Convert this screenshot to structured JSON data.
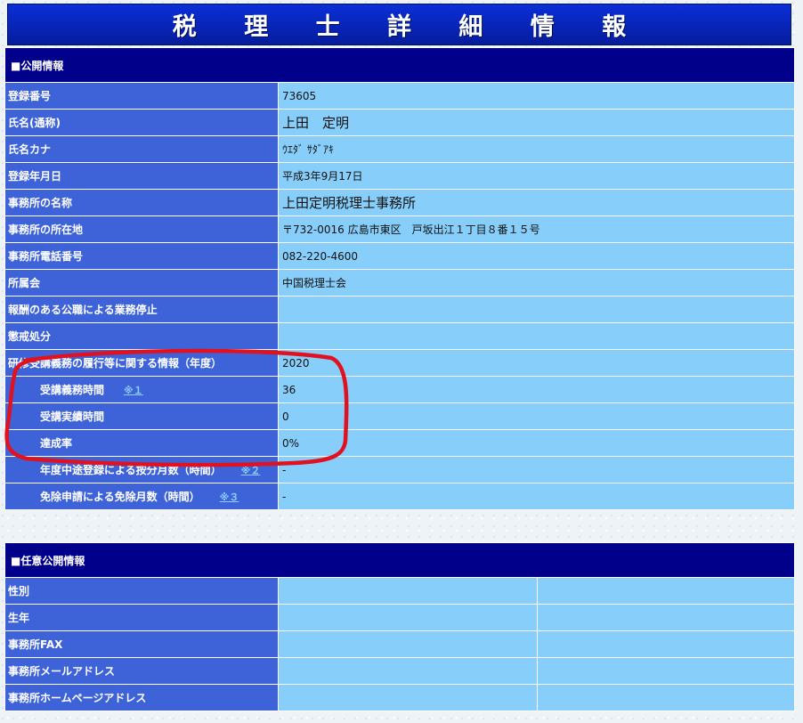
{
  "title": "税 理 士 詳 細 情 報",
  "public_section": {
    "header": "■公開情報",
    "rows": [
      {
        "label": "登録番号",
        "value": "73605"
      },
      {
        "label": "氏名(通称)",
        "value": "上田　定明"
      },
      {
        "label": "氏名カナ",
        "value": "ｳｴﾀﾞ ｻﾀﾞｱｷ"
      },
      {
        "label": "登録年月日",
        "value": "平成3年9月17日"
      },
      {
        "label": "事務所の名称",
        "value": "上田定明税理士事務所"
      },
      {
        "label": "事務所の所在地",
        "value": "〒732-0016 広島市東区　戸坂出江１丁目８番１５号"
      },
      {
        "label": "事務所電話番号",
        "value": "082-220-4600"
      },
      {
        "label": "所属会",
        "value": "中国税理士会"
      },
      {
        "label": "報酬のある公職による業務停止",
        "value": ""
      },
      {
        "label": "懲戒処分",
        "value": ""
      },
      {
        "label": "研修受講義務の履行等に関する情報（年度）",
        "value": "2020"
      },
      {
        "label": "受講義務時間",
        "note": "※１",
        "value": "36"
      },
      {
        "label": "受講実績時間",
        "value": "0"
      },
      {
        "label": "達成率",
        "value": "0%"
      },
      {
        "label": "年度中途登録による按分月数（時間）",
        "note": "※２",
        "value": "-"
      },
      {
        "label": "免除申請による免除月数（時間）",
        "note": "※３",
        "value": "-"
      }
    ]
  },
  "optional_section": {
    "header": "■任意公開情報",
    "rows": [
      {
        "label": "性別"
      },
      {
        "label": "生年"
      },
      {
        "label": "事務所FAX"
      },
      {
        "label": "事務所メールアドレス"
      },
      {
        "label": "事務所ホームページアドレス"
      }
    ]
  },
  "annotation_color": "#e0121f"
}
